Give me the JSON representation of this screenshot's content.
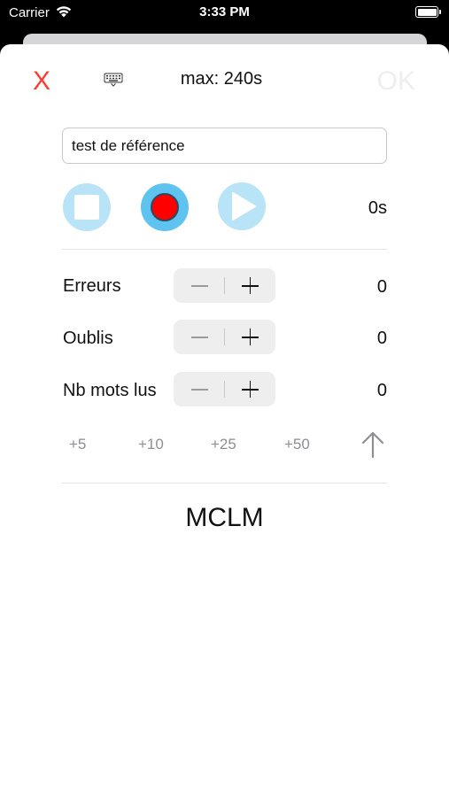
{
  "status_bar": {
    "carrier": "Carrier",
    "time": "3:33 PM"
  },
  "header": {
    "close_label": "X",
    "max_label": "max: 240s",
    "ok_label": "OK",
    "keyboard_icon": "keyboard-icon"
  },
  "name_field": {
    "value": "test de référence"
  },
  "recorder": {
    "stop_icon": "stop-icon",
    "record_icon": "record-icon",
    "play_icon": "play-icon",
    "duration": "0s"
  },
  "counters": [
    {
      "label": "Erreurs",
      "value": "0"
    },
    {
      "label": "Oublis",
      "value": "0"
    },
    {
      "label": "Nb mots lus",
      "value": "0"
    }
  ],
  "quick_add": [
    "+5",
    "+10",
    "+25",
    "+50"
  ],
  "footer": {
    "title": "MCLM"
  },
  "colors": {
    "close": "#ff3b30",
    "record_outer": "#5ec3ee",
    "button_light": "#b9e3f6",
    "record_dot": "#ff0000",
    "ok_disabled": "#eeeeef"
  }
}
